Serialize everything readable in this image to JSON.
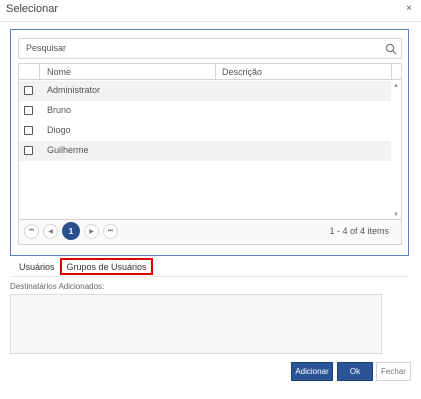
{
  "dialog": {
    "title": "Selecionar",
    "close_glyph": "×"
  },
  "search": {
    "placeholder": "Pesquisar",
    "icon": "search-icon"
  },
  "grid": {
    "columns": [
      "Nome",
      "Descrição"
    ],
    "rows": [
      {
        "name": "Administrator",
        "description": "",
        "checked": false
      },
      {
        "name": "Bruno",
        "description": "",
        "checked": false
      },
      {
        "name": "Diogo",
        "description": "",
        "checked": false
      },
      {
        "name": "Guilherme",
        "description": "",
        "checked": false
      }
    ]
  },
  "pager": {
    "first": "⏮",
    "prev": "◀",
    "current_page": "1",
    "next": "▶",
    "last": "⏭",
    "info": "1 - 4 of 4 items"
  },
  "tabs": {
    "users": "Usuários",
    "groups": "Grupos de Usuários"
  },
  "recipients": {
    "label": "Destinatários Adicionados:"
  },
  "buttons": {
    "add": "Adicionar",
    "ok": "Ok",
    "close": "Fechar"
  },
  "colors": {
    "primary": "#2a5495",
    "highlight": "#e00000",
    "panel_border": "#5a7fb6"
  }
}
